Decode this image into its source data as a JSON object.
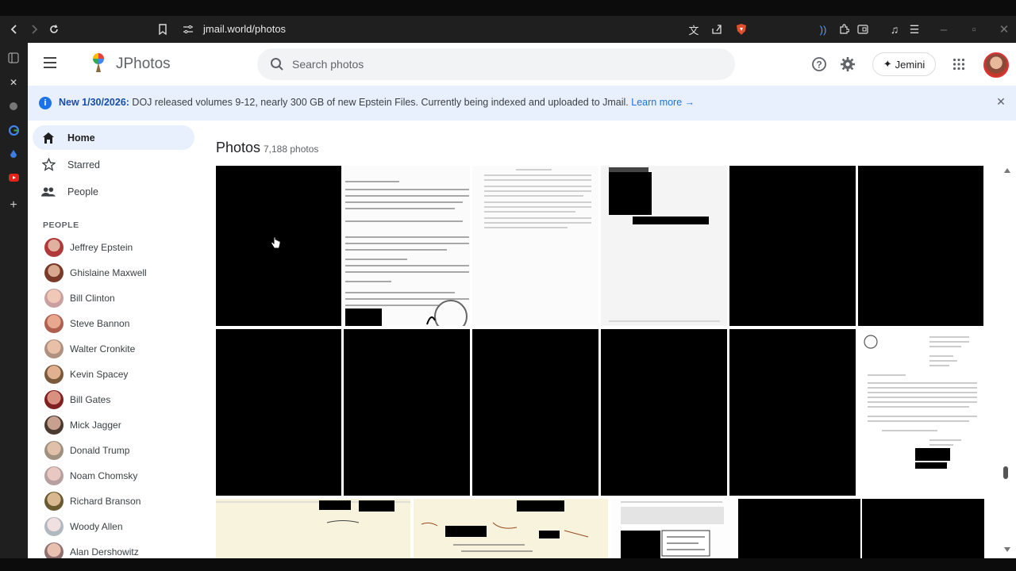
{
  "browser": {
    "url": "jmail.world/photos"
  },
  "app": {
    "title": "JPhotos"
  },
  "search": {
    "placeholder": "Search photos"
  },
  "header": {
    "jemini_label": "Jemini"
  },
  "banner": {
    "prefix": "New 1/30/2026:",
    "message": " DOJ released volumes 9-12, nearly 300 GB of new Epstein Files. Currently being indexed and uploaded to Jmail. ",
    "link": "Learn more →"
  },
  "sidebar": {
    "nav": [
      {
        "label": "Home",
        "icon": "home-icon",
        "active": true
      },
      {
        "label": "Starred",
        "icon": "star-icon",
        "active": false
      },
      {
        "label": "People",
        "icon": "people-icon",
        "active": false
      }
    ],
    "people_heading": "PEOPLE",
    "people": [
      {
        "name": "Jeffrey Epstein"
      },
      {
        "name": "Ghislaine Maxwell"
      },
      {
        "name": "Bill Clinton"
      },
      {
        "name": "Steve Bannon"
      },
      {
        "name": "Walter Cronkite"
      },
      {
        "name": "Kevin Spacey"
      },
      {
        "name": "Bill Gates"
      },
      {
        "name": "Mick Jagger"
      },
      {
        "name": "Donald Trump"
      },
      {
        "name": "Noam Chomsky"
      },
      {
        "name": "Richard Branson"
      },
      {
        "name": "Woody Allen"
      },
      {
        "name": "Alan Dershowitz"
      }
    ]
  },
  "main": {
    "title": "Photos",
    "count": "7,188 photos"
  },
  "colors": {
    "accent": "#1a73e8",
    "banner_bg": "#e8f0fe",
    "active_nav_bg": "#e8f0fe"
  }
}
